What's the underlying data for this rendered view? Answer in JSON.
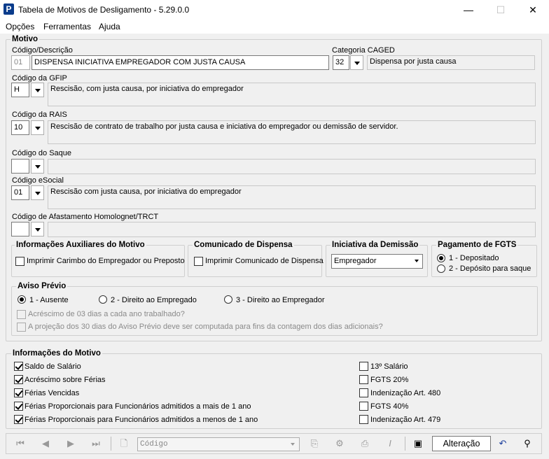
{
  "window": {
    "title": "Tabela de Motivos de Desligamento - 5.29.0.0",
    "minimize": "—",
    "maximize": "☐",
    "close": "✕"
  },
  "menu": {
    "opcoes": "Opções",
    "ferramentas": "Ferramentas",
    "ajuda": "Ajuda"
  },
  "motivo": {
    "group_label": "Motivo",
    "codigo_label": "Código/Descrição",
    "codigo": "01",
    "descricao": "DISPENSA INICIATIVA EMPREGADOR COM JUSTA CAUSA",
    "caged_label": "Categoria CAGED",
    "caged_code": "32",
    "caged_desc": "Dispensa por justa causa",
    "gfip_label": "Código da GFIP",
    "gfip_code": "H",
    "gfip_desc": "Rescisão, com justa causa, por iniciativa do empregador",
    "rais_label": "Código da RAIS",
    "rais_code": "10",
    "rais_desc": "Rescisão de contrato de trabalho por justa causa e iniciativa do empregador ou demissão de servidor.",
    "saque_label": "Código do Saque",
    "saque_code": "",
    "saque_desc": "",
    "esocial_label": "Código eSocial",
    "esocial_code": "01",
    "esocial_desc": "Rescisão com justa causa, por iniciativa do empregador",
    "afast_label": "Código de Afastamento Homolognet/TRCT",
    "afast_code": "",
    "afast_desc": ""
  },
  "aux": {
    "label": "Informações Auxiliares do Motivo",
    "carimbo": "Imprimir Carimbo do Empregador ou Preposto"
  },
  "comunicado": {
    "label": "Comunicado de Dispensa",
    "imprimir": "Imprimir Comunicado de Dispensa"
  },
  "iniciativa": {
    "label": "Iniciativa da Demissão",
    "value": "Empregador"
  },
  "fgts": {
    "label": "Pagamento de FGTS",
    "opt1": "1 - Depositado",
    "opt2": "2 - Depósito para saque",
    "selected": 1
  },
  "aviso": {
    "label": "Aviso Prévio",
    "opt1": "1 - Ausente",
    "opt2": "2 - Direito ao Empregado",
    "opt3": "3 - Direito ao Empregador",
    "selected": 1,
    "acrescimo": "Acréscimo de 03 dias a cada ano trabalhado?",
    "projecao": "A projeção dos 30 dias do Aviso Prévio deve ser computada para fins da contagem dos dias adicionais?"
  },
  "info": {
    "label": "Informações do Motivo",
    "left": [
      {
        "label": "Saldo de Salário",
        "checked": true
      },
      {
        "label": "Acréscimo sobre Férias",
        "checked": true
      },
      {
        "label": "Férias Vencidas",
        "checked": true
      },
      {
        "label": "Férias Proporcionais para Funcionários admitidos a mais de 1 ano",
        "checked": true
      },
      {
        "label": "Férias Proporcionais para Funcionários admitidos a menos de 1 ano",
        "checked": true
      }
    ],
    "right": [
      {
        "label": "13º Salário",
        "checked": false
      },
      {
        "label": "FGTS 20%",
        "checked": false
      },
      {
        "label": "Indenização Art. 480",
        "checked": false
      },
      {
        "label": "FGTS 40%",
        "checked": false
      },
      {
        "label": "Indenização Art. 479",
        "checked": false
      }
    ]
  },
  "toolbar": {
    "search_placeholder": "Código",
    "status": "Alteração"
  }
}
